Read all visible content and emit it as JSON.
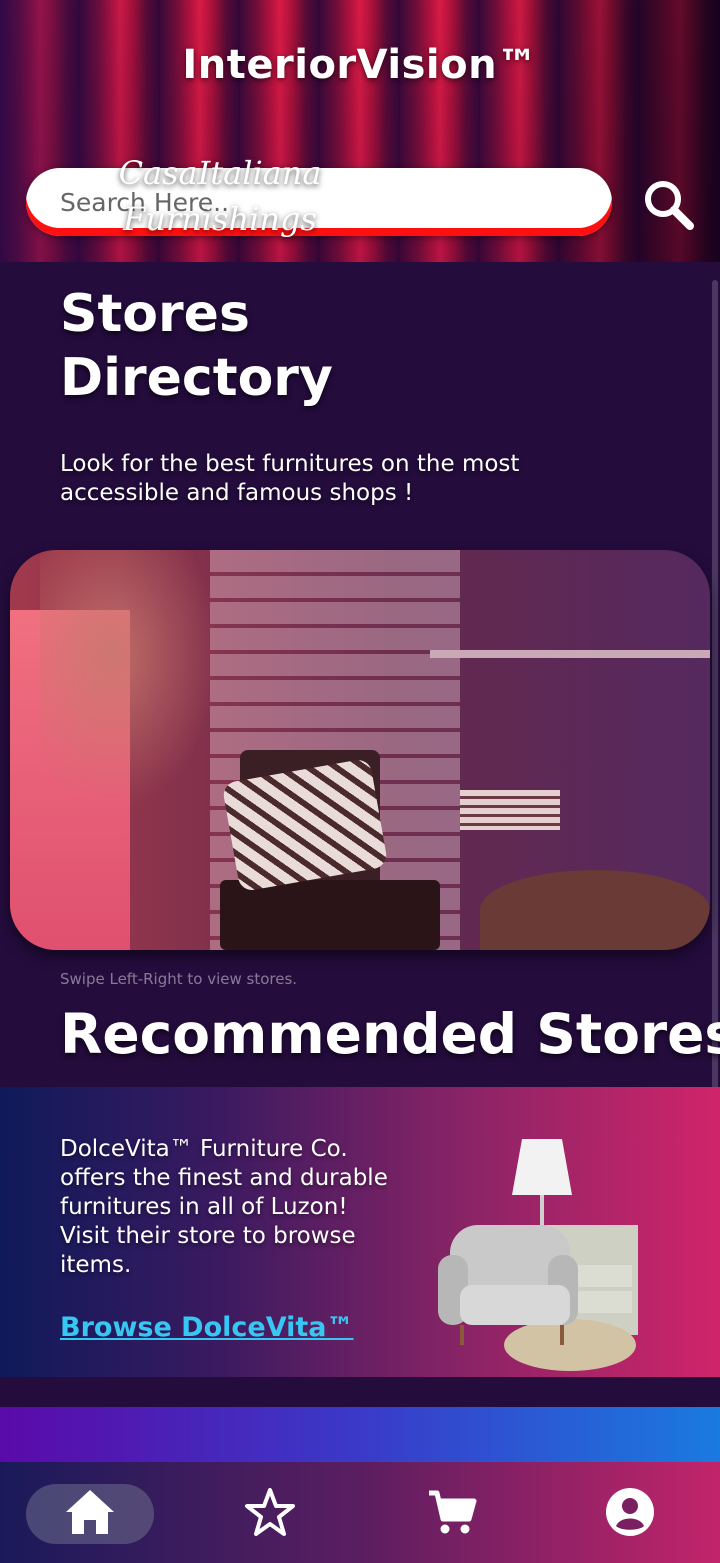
{
  "header": {
    "app_title": "InteriorVision™",
    "search": {
      "placeholder": "Search Here..",
      "value": ""
    },
    "search_icon": "search-icon"
  },
  "stores_section": {
    "title": "Stores Directory",
    "description": "Look for the best furnitures on the most accessible and famous shops !"
  },
  "carousel": {
    "store_name": "CasaItaliana Furnishings",
    "hint": "Swipe Left-Right to view stores."
  },
  "recommended": {
    "title": "Recommended Stores",
    "description": "DolceVita™ Furniture Co. offers the finest and durable furnitures in all of Luzon! Visit their store to browse items.",
    "link_label": "Browse DolceVita™"
  },
  "colors": {
    "accent_link": "#36c7f2",
    "search_border": "#ff1010",
    "background": "#240c3d"
  },
  "bottom_nav": {
    "items": [
      {
        "icon": "home-icon",
        "active": true
      },
      {
        "icon": "star-icon",
        "active": false
      },
      {
        "icon": "cart-icon",
        "active": false
      },
      {
        "icon": "account-icon",
        "active": false
      }
    ]
  }
}
